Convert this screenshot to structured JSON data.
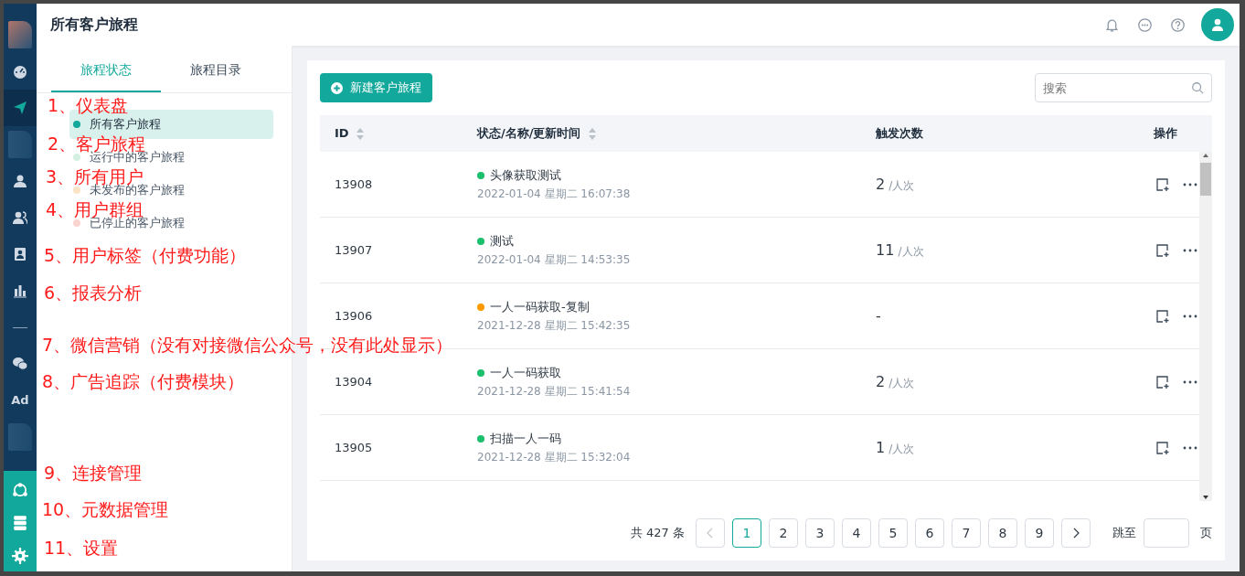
{
  "header": {
    "title": "所有客户旅程",
    "icons": [
      {
        "kind": "bell"
      },
      {
        "kind": "chat"
      },
      {
        "kind": "help"
      }
    ],
    "avatar": {
      "kind": "user"
    }
  },
  "sidebar": {
    "items": [
      {
        "kind": "blurred"
      },
      {
        "kind": "gauge",
        "selected": false
      },
      {
        "kind": "plane",
        "selected": true
      },
      {
        "kind": "blurred"
      },
      {
        "kind": "user",
        "selected": false
      },
      {
        "kind": "users",
        "selected": false
      },
      {
        "kind": "badge",
        "selected": false
      },
      {
        "kind": "chart",
        "selected": false
      },
      {
        "kind": "divider"
      },
      {
        "kind": "wechat",
        "selected": false
      },
      {
        "kind": "text",
        "label": "Ad",
        "selected": false
      },
      {
        "kind": "blurred"
      }
    ],
    "footer_items": [
      {
        "kind": "hub"
      },
      {
        "kind": "database"
      },
      {
        "kind": "gear"
      }
    ]
  },
  "panel": {
    "tabs": [
      {
        "label": "旅程状态",
        "selected": true
      },
      {
        "label": "旅程目录",
        "selected": false
      }
    ],
    "filters": [
      {
        "label": "所有客户旅程",
        "color": "#12a89b",
        "selected": true
      },
      {
        "label": "运行中的客户旅程",
        "color": "#d4f0e2",
        "selected": false
      },
      {
        "label": "未发布的客户旅程",
        "color": "#fde4c4",
        "selected": false
      },
      {
        "label": "已停止的客户旅程",
        "color": "#fad4d0",
        "selected": false
      }
    ]
  },
  "toolbar": {
    "new_button": "新建客户旅程",
    "search": {
      "placeholder": "搜索"
    }
  },
  "table": {
    "columns": [
      {
        "label": "ID",
        "sortable": true
      },
      {
        "label": "状态/名称/更新时间",
        "sortable": true
      },
      {
        "label": "触发次数",
        "sortable": false
      },
      {
        "label": "操作",
        "sortable": false
      }
    ],
    "rows": [
      {
        "id": "13908",
        "color": "#1bbf6b",
        "name": "头像获取测试",
        "time": "2022-01-04 星期二 16:07:38",
        "count": "2",
        "unit": "/人次"
      },
      {
        "id": "13907",
        "color": "#1bbf6b",
        "name": "测试",
        "time": "2022-01-04 星期二 14:53:35",
        "count": "11",
        "unit": "/人次"
      },
      {
        "id": "13906",
        "color": "#ff9900",
        "name": "一人一码获取-复制",
        "time": "2021-12-28 星期二 15:42:35",
        "count": "-"
      },
      {
        "id": "13904",
        "color": "#1bbf6b",
        "name": "一人一码获取",
        "time": "2021-12-28 星期二 15:41:54",
        "count": "2",
        "unit": "/人次"
      },
      {
        "id": "13905",
        "color": "#1bbf6b",
        "name": "扫描一人一码",
        "time": "2021-12-28 星期二 15:32:04",
        "count": "1",
        "unit": "/人次"
      }
    ]
  },
  "pagination": {
    "total": "共 427 条",
    "prev_disabled": true,
    "next_disabled": false,
    "pages": [
      {
        "label": "1",
        "selected": true
      },
      {
        "label": "2",
        "selected": false
      },
      {
        "label": "3",
        "selected": false
      },
      {
        "label": "4",
        "selected": false
      },
      {
        "label": "5",
        "selected": false
      },
      {
        "label": "6",
        "selected": false
      },
      {
        "label": "7",
        "selected": false
      },
      {
        "label": "8",
        "selected": false
      },
      {
        "label": "9",
        "selected": false
      }
    ],
    "jump_label": "跳至",
    "jump_suffix": "页"
  },
  "annotations": [
    {
      "text": "1、仪表盘"
    },
    {
      "text": "2、客户旅程"
    },
    {
      "text": "3、所有用户"
    },
    {
      "text": "4、用户群组"
    },
    {
      "text": "5、用户标签（付费功能）"
    },
    {
      "text": "6、报表分析"
    },
    {
      "text": "7、微信营销（没有对接微信公众号，没有此处显示）"
    },
    {
      "text": "8、广告追踪（付费模块）"
    },
    {
      "text": "9、连接管理"
    },
    {
      "text": "10、元数据管理"
    },
    {
      "text": "11、设置"
    }
  ]
}
